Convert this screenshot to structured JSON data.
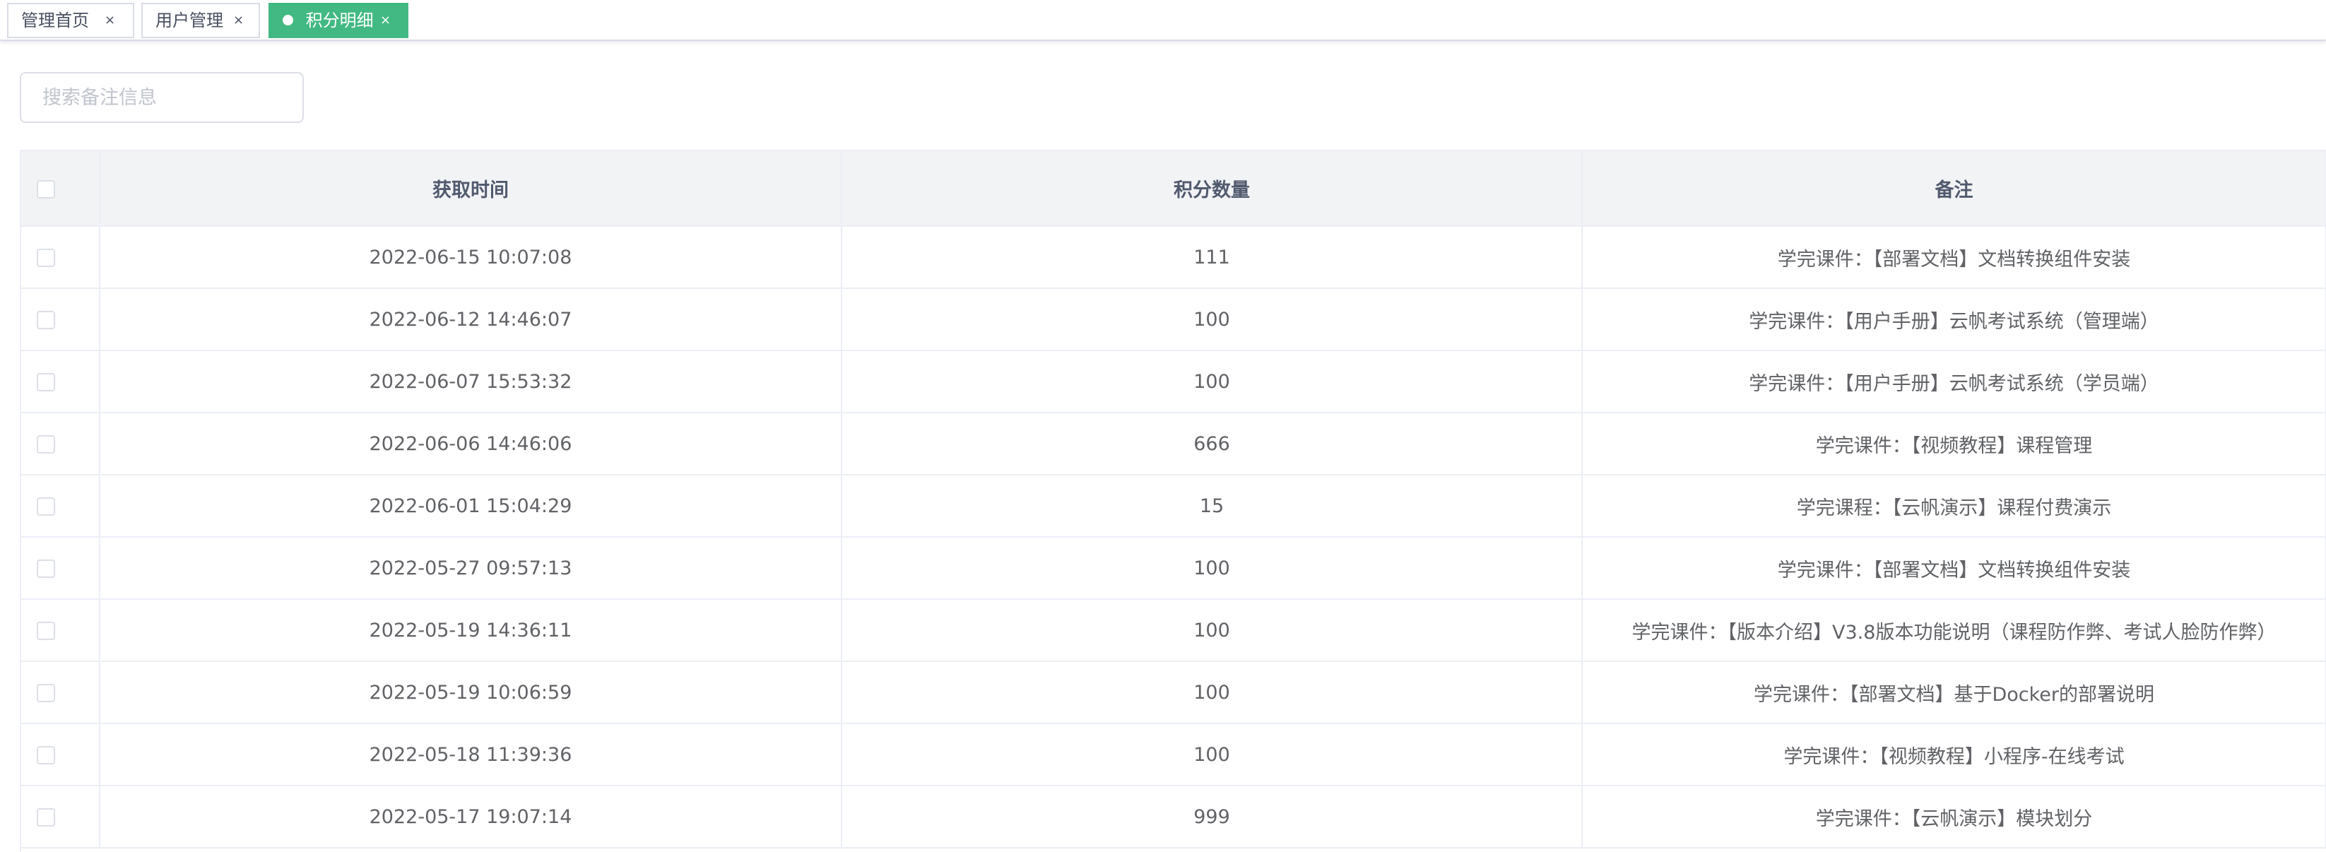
{
  "tabs": [
    {
      "label": "管理首页",
      "active": false
    },
    {
      "label": "用户管理",
      "active": false
    },
    {
      "label": "积分明细",
      "active": true
    }
  ],
  "tab_close_glyph": "×",
  "search": {
    "placeholder": "搜索备注信息",
    "value": ""
  },
  "table": {
    "headers": [
      "获取时间",
      "积分数量",
      "备注"
    ],
    "rows": [
      {
        "time": "2022-06-15 10:07:08",
        "points": "111",
        "note": "学完课件：【部署文档】文档转换组件安装"
      },
      {
        "time": "2022-06-12 14:46:07",
        "points": "100",
        "note": "学完课件：【用户手册】云帆考试系统（管理端）"
      },
      {
        "time": "2022-06-07 15:53:32",
        "points": "100",
        "note": "学完课件：【用户手册】云帆考试系统（学员端）"
      },
      {
        "time": "2022-06-06 14:46:06",
        "points": "666",
        "note": "学完课件：【视频教程】课程管理"
      },
      {
        "time": "2022-06-01 15:04:29",
        "points": "15",
        "note": "学完课程：【云帆演示】课程付费演示"
      },
      {
        "time": "2022-05-27 09:57:13",
        "points": "100",
        "note": "学完课件：【部署文档】文档转换组件安装"
      },
      {
        "time": "2022-05-19 14:36:11",
        "points": "100",
        "note": "学完课件：【版本介绍】V3.8版本功能说明（课程防作弊、考试人脸防作弊）"
      },
      {
        "time": "2022-05-19 10:06:59",
        "points": "100",
        "note": "学完课件：【部署文档】基于Docker的部署说明"
      },
      {
        "time": "2022-05-18 11:39:36",
        "points": "100",
        "note": "学完课件：【视频教程】小程序-在线考试"
      },
      {
        "time": "2022-05-17 19:07:14",
        "points": "999",
        "note": "学完课件：【云帆演示】模块划分"
      }
    ]
  },
  "colors": {
    "accent": "#42b983",
    "border": "#ebeef5",
    "header_bg": "#f2f3f5"
  }
}
